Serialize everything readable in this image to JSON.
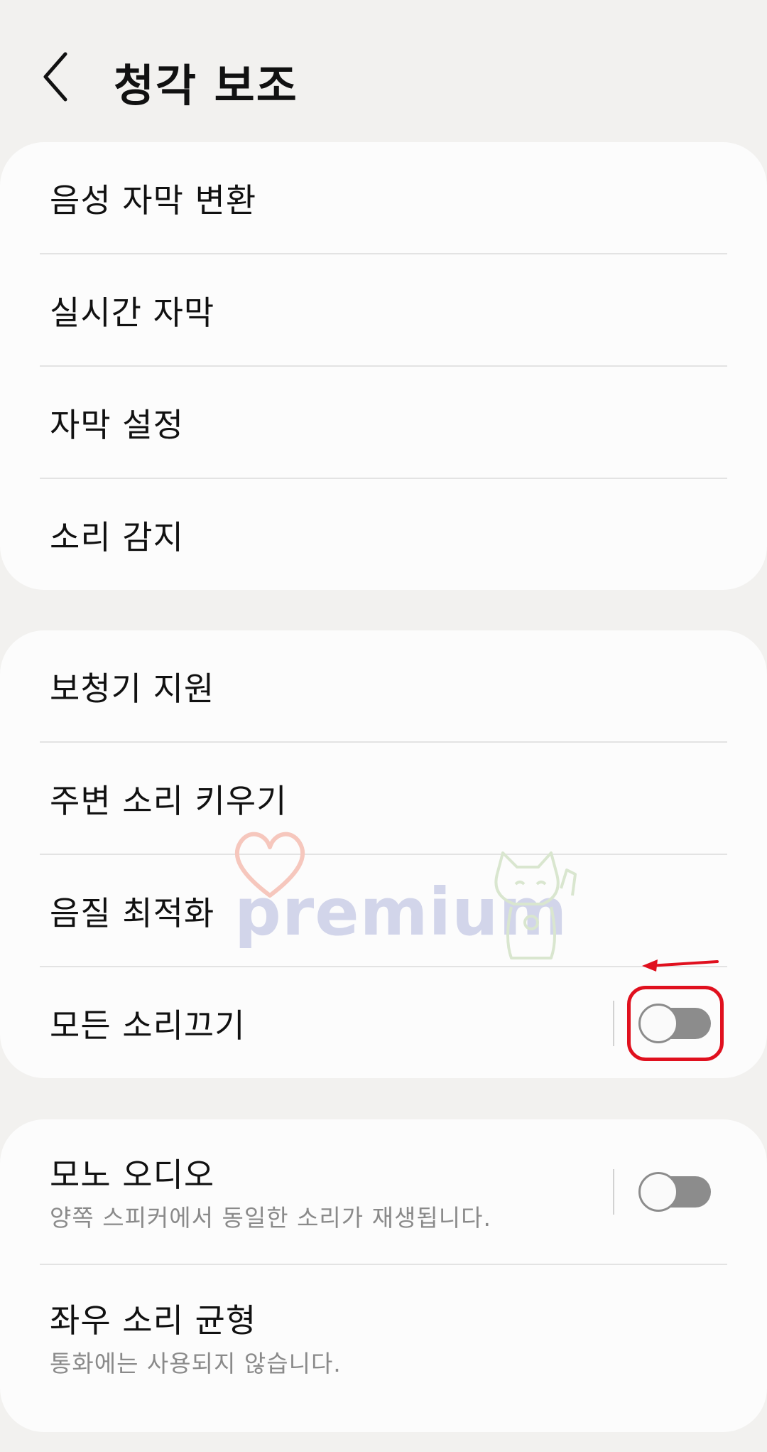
{
  "header": {
    "title": "청각 보조"
  },
  "groups": [
    {
      "items": [
        {
          "label": "음성 자막 변환"
        },
        {
          "label": "실시간 자막"
        },
        {
          "label": "자막 설정"
        },
        {
          "label": "소리 감지"
        }
      ]
    },
    {
      "items": [
        {
          "label": "보청기 지원"
        },
        {
          "label": "주변 소리 키우기"
        },
        {
          "label": "음질 최적화"
        },
        {
          "label": "모든 소리끄기",
          "toggle": false
        }
      ]
    },
    {
      "items": [
        {
          "label": "모노 오디오",
          "sub": "양쪽 스피커에서 동일한 소리가 재생됩니다.",
          "toggle": false
        },
        {
          "label": "좌우 소리 균형",
          "sub": "통화에는 사용되지 않습니다."
        }
      ]
    }
  ],
  "watermark": {
    "text": "premium"
  },
  "colors": {
    "background": "#f2f1ef",
    "card": "#fcfcfc",
    "toggle_off": "#8c8c8c",
    "annotation_red": "#e0101e"
  }
}
